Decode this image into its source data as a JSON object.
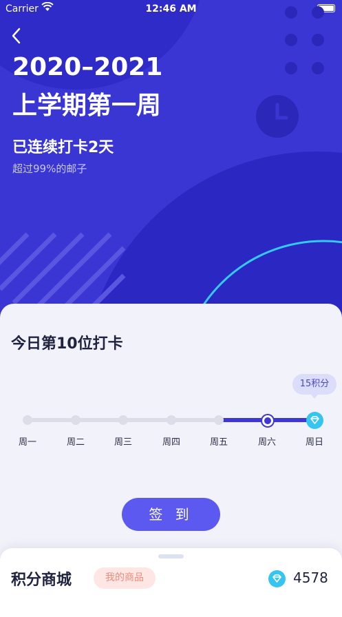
{
  "status_bar": {
    "carrier": "Carrier",
    "time": "12:46 AM"
  },
  "header": {
    "title_line1": "2020–2021",
    "title_line2": "上学期第一周",
    "streak": "已连续打卡2天",
    "rank": "超过99%的邮子"
  },
  "checkin_card": {
    "title": "今日第10位打卡",
    "reward_tooltip": "15积分",
    "days": [
      "周一",
      "周二",
      "周三",
      "周四",
      "周五",
      "周六",
      "周日"
    ],
    "button_label": "签 到"
  },
  "shop": {
    "title": "积分商城",
    "my_goods_label": "我的商品",
    "points": "4578"
  },
  "colors": {
    "primary": "#3a36d3",
    "accent": "#5c59f0",
    "gem": "#35c5f0"
  },
  "icons": [
    "back-chevron-icon",
    "wifi-icon",
    "battery-icon",
    "clock-icon",
    "gem-icon"
  ]
}
